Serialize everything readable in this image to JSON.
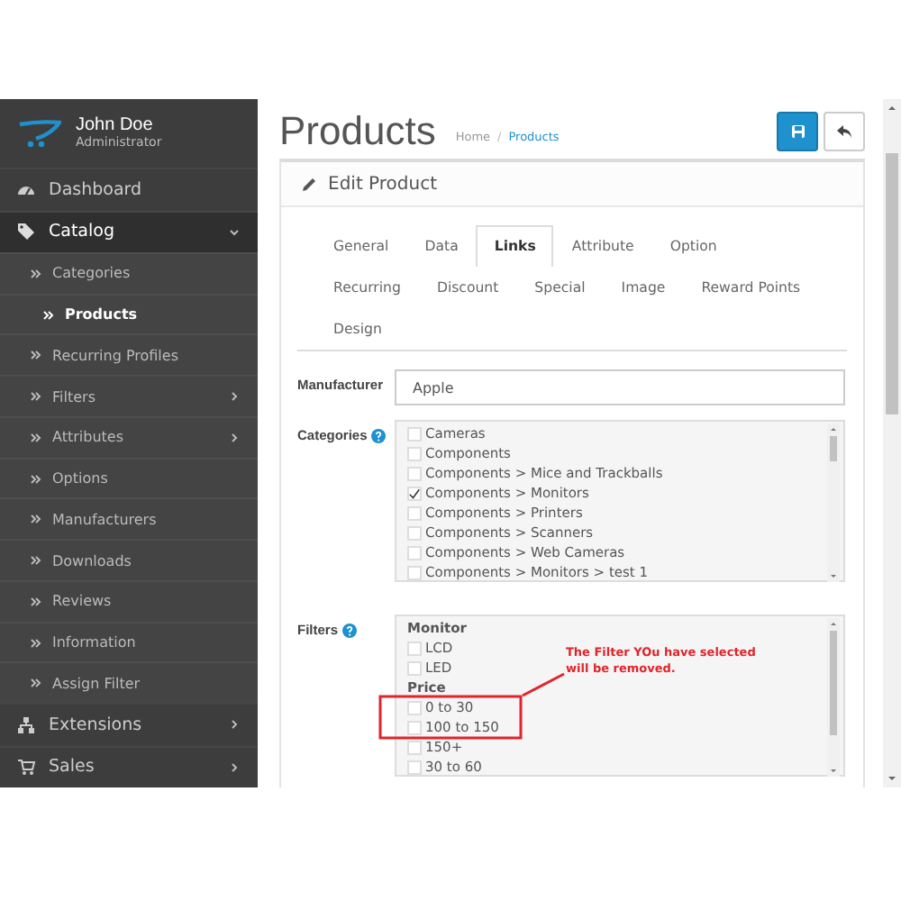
{
  "user": {
    "name": "John Doe",
    "role": "Administrator"
  },
  "menu": [
    {
      "label": "Dashboard",
      "expandable": false,
      "expanded": false
    },
    {
      "label": "Catalog",
      "expandable": true,
      "expanded": true,
      "children": [
        {
          "label": "Categories",
          "selected": false,
          "expandable": false
        },
        {
          "label": "Products",
          "selected": true,
          "expandable": false
        },
        {
          "label": "Recurring Profiles",
          "selected": false,
          "expandable": false
        },
        {
          "label": "Filters",
          "selected": false,
          "expandable": true
        },
        {
          "label": "Attributes",
          "selected": false,
          "expandable": true
        },
        {
          "label": "Options",
          "selected": false,
          "expandable": false
        },
        {
          "label": "Manufacturers",
          "selected": false,
          "expandable": false
        },
        {
          "label": "Downloads",
          "selected": false,
          "expandable": false
        },
        {
          "label": "Reviews",
          "selected": false,
          "expandable": false
        },
        {
          "label": "Information",
          "selected": false,
          "expandable": false
        },
        {
          "label": "Assign Filter",
          "selected": false,
          "expandable": false
        }
      ]
    },
    {
      "label": "Extensions",
      "expandable": true,
      "expanded": false
    },
    {
      "label": "Sales",
      "expandable": true,
      "expanded": false
    }
  ],
  "page": {
    "title": "Products",
    "breadcrumb_separator": "/",
    "breadcrumb": [
      {
        "label": "Home",
        "current": false
      },
      {
        "label": "Products",
        "current": true
      }
    ],
    "buttons": [
      {
        "kind": "save"
      },
      {
        "kind": "back"
      }
    ]
  },
  "panel": {
    "title": "Edit Product",
    "tabs": [
      {
        "label": "General",
        "selected": false
      },
      {
        "label": "Data",
        "selected": false
      },
      {
        "label": "Links",
        "selected": true
      },
      {
        "label": "Attribute",
        "selected": false
      },
      {
        "label": "Option",
        "selected": false
      },
      {
        "label": "Recurring",
        "selected": false
      },
      {
        "label": "Discount",
        "selected": false
      },
      {
        "label": "Special",
        "selected": false
      },
      {
        "label": "Image",
        "selected": false
      },
      {
        "label": "Reward Points",
        "selected": false
      },
      {
        "label": "Design",
        "selected": false
      }
    ],
    "manufacturer": {
      "label": "Manufacturer",
      "value": "Apple"
    },
    "categories": {
      "label": "Categories",
      "items": [
        {
          "label": "Cameras",
          "checked": false
        },
        {
          "label": "Components",
          "checked": false
        },
        {
          "label": "Components > Mice and Trackballs",
          "checked": false
        },
        {
          "label": "Components > Monitors",
          "checked": true
        },
        {
          "label": "Components > Printers",
          "checked": false
        },
        {
          "label": "Components > Scanners",
          "checked": false
        },
        {
          "label": "Components > Web Cameras",
          "checked": false
        },
        {
          "label": "Components  >  Monitors  >  test 1",
          "checked": false
        }
      ]
    },
    "filters": {
      "label": "Filters",
      "groups": [
        {
          "name": "Monitor",
          "items": [
            {
              "label": "LCD",
              "checked": false
            },
            {
              "label": "LED",
              "checked": false
            }
          ]
        },
        {
          "name": "Price",
          "items": [
            {
              "label": "0 to 30",
              "checked": false
            },
            {
              "label": "100 to 150",
              "checked": false
            },
            {
              "label": "150+",
              "checked": false
            },
            {
              "label": "30 to 60",
              "checked": false
            }
          ]
        }
      ],
      "annotation": "The Filter YOu have selected will be removed."
    }
  }
}
